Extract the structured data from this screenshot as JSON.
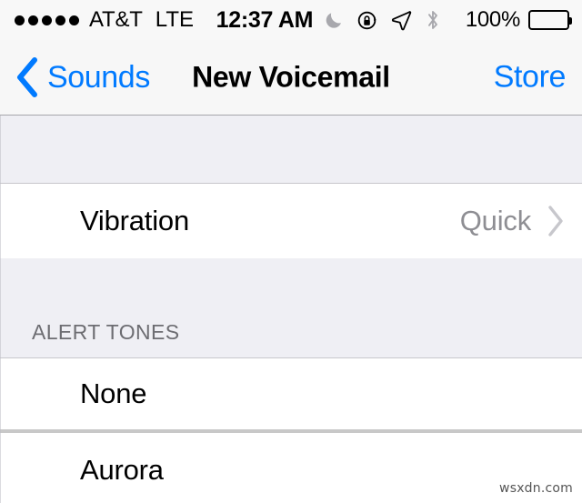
{
  "status_bar": {
    "signal_dots": 5,
    "carrier": "AT&T",
    "network_type": "LTE",
    "time": "12:37 AM",
    "do_not_disturb_icon": "moon-icon",
    "rotation_lock_icon": "portrait-orientation-lock-icon",
    "location_icon": "location-arrow-icon",
    "bluetooth_icon": "bluetooth-icon",
    "battery_percent": "100%",
    "battery_icon": "battery-full-icon"
  },
  "nav_bar": {
    "back_icon": "chevron-left-icon",
    "back_label": "Sounds",
    "title": "New Voicemail",
    "right_action": "Store"
  },
  "sections": [
    {
      "header": "",
      "rows": [
        {
          "title": "Vibration",
          "value": "Quick",
          "accessory": "disclosure-chevron-icon"
        }
      ]
    },
    {
      "header": "ALERT TONES",
      "rows": [
        {
          "title": "None",
          "value": "",
          "accessory": ""
        },
        {
          "title": "Aurora",
          "value": "",
          "accessory": ""
        }
      ]
    }
  ],
  "watermark": "wsxdn.com",
  "colors": {
    "accent_blue": "#007aff",
    "group_background": "#efeff4",
    "bar_background": "#f7f7f7",
    "secondary_text": "#8e8e93",
    "header_text": "#6d6d72",
    "separator": "#c8c7cc"
  }
}
